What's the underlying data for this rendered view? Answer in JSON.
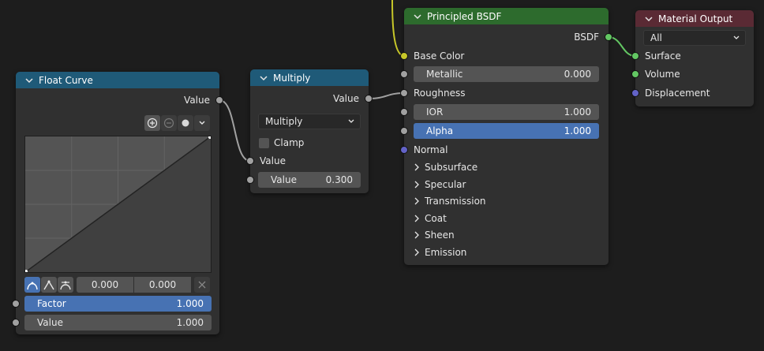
{
  "float_curve": {
    "title": "Float Curve",
    "output_value": "Value",
    "point_x": "0.000",
    "point_y": "0.000",
    "factor_label": "Factor",
    "factor_value": "1.000",
    "value_label": "Value",
    "value_value": "1.000"
  },
  "multiply": {
    "title": "Multiply",
    "output_value": "Value",
    "operation": "Multiply",
    "clamp_label": "Clamp",
    "input_value": "Value",
    "value_label": "Value",
    "value_value": "0.300"
  },
  "principled": {
    "title": "Principled BSDF",
    "output": "BSDF",
    "base_color": "Base Color",
    "metallic_label": "Metallic",
    "metallic_value": "0.000",
    "roughness": "Roughness",
    "ior_label": "IOR",
    "ior_value": "1.000",
    "alpha_label": "Alpha",
    "alpha_value": "1.000",
    "normal": "Normal",
    "panels": [
      "Subsurface",
      "Specular",
      "Transmission",
      "Coat",
      "Sheen",
      "Emission"
    ]
  },
  "material_output": {
    "title": "Material Output",
    "target": "All",
    "surface": "Surface",
    "volume": "Volume",
    "displacement": "Displacement"
  },
  "colors": {
    "background": "#1d1d1d",
    "node_body": "#303030",
    "header_converter": "#1f5a78",
    "header_shader": "#2d6b2d",
    "header_output": "#5a2a34",
    "slider_active": "#4772b3",
    "socket_float": "#a1a1a1",
    "socket_color": "#c7c729",
    "socket_shader": "#63c763",
    "socket_vector": "#6363c7"
  }
}
